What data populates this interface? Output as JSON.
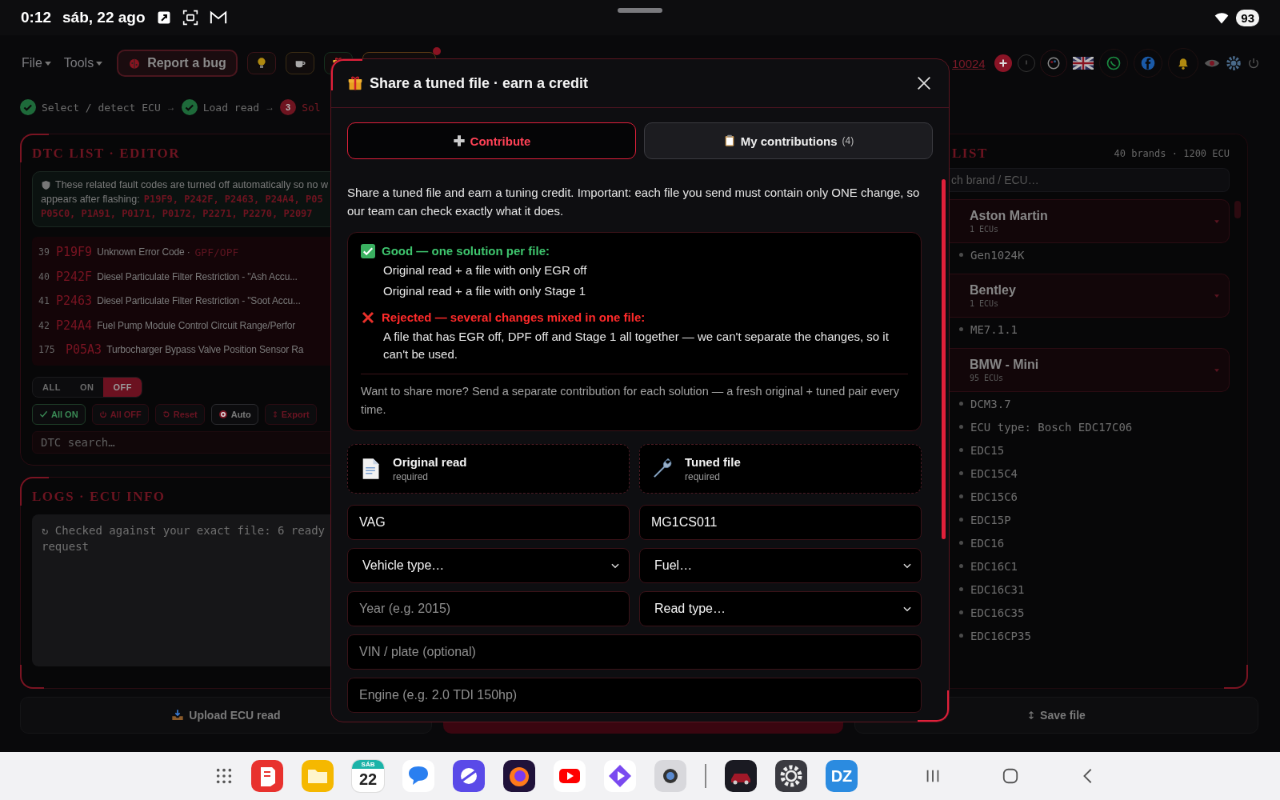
{
  "status_bar": {
    "time": "0:12",
    "date": "sáb, 22 ago",
    "battery": "93"
  },
  "toolbar": {
    "menus": [
      {
        "label": "File"
      },
      {
        "label": "Tools"
      }
    ],
    "report_button": "Report a bug",
    "credits": "10024"
  },
  "steps": [
    {
      "kind": "done",
      "label": "Select / detect ECU",
      "arrow": "→"
    },
    {
      "kind": "done",
      "label": "Load read",
      "arrow": "→"
    },
    {
      "kind": "current",
      "number": "3",
      "label": "Sol"
    }
  ],
  "dtc_panel": {
    "title": "DTC LIST · EDITOR",
    "notice": [
      {
        "text": "These related fault codes are turned off automatically so no w"
      },
      {
        "text": "appears after flashing:",
        "codes": "P19F9, P242F, P2463, P24A4, P05"
      },
      {
        "codes": "P05C0, P1A91, P0171, P0172, P2271, P2270, P2097"
      }
    ],
    "rows": [
      {
        "number": "39",
        "code": "P19F9",
        "description": "Unknown Error Code ·",
        "tag": "GPF/OPF"
      },
      {
        "number": "40",
        "code": "P242F",
        "description": "Diesel Particulate Filter Restriction - \"Ash Accu..."
      },
      {
        "number": "41",
        "code": "P2463",
        "description": "Diesel Particulate Filter Restriction - \"Soot Accu..."
      },
      {
        "number": "42",
        "code": "P24A4",
        "description": "Fuel Pump Module Control Circuit Range/Perfor"
      },
      {
        "number": "175",
        "code": "P05A3",
        "description": "Turbocharger Bypass Valve Position Sensor Ra"
      }
    ],
    "filter": [
      {
        "label": "ALL",
        "selected": false
      },
      {
        "label": "ON",
        "selected": false
      },
      {
        "label": "OFF",
        "selected": true
      }
    ],
    "actions": [
      {
        "kind": "enable",
        "label": "All ON"
      },
      {
        "kind": "disable",
        "label": "All OFF"
      },
      {
        "kind": "reset",
        "label": "Reset"
      },
      {
        "kind": "auto",
        "label": "Auto"
      },
      {
        "kind": "export",
        "label": "Export"
      }
    ],
    "search_placeholder": "DTC search…"
  },
  "logs_panel": {
    "title": "LOGS · ECU INFO",
    "lines": [
      "↻ Checked against your exact file: 6 ready",
      "request"
    ]
  },
  "bottom_bar": {
    "upload_button": "Upload ECU read",
    "save_button": "Save file"
  },
  "right_panel": {
    "title": "LIST",
    "count": "40 brands · 1200 ECU",
    "search_placeholder": "ch brand / ECU…",
    "brands": [
      {
        "name": "Aston Martin",
        "count": "1 ECUs",
        "expanded": true,
        "ecus": [
          "Gen1024K"
        ]
      },
      {
        "name": "Bentley",
        "count": "1 ECUs",
        "expanded": true,
        "ecus": [
          "ME7.1.1"
        ]
      },
      {
        "name": "BMW - Mini",
        "count": "95 ECUs",
        "expanded": true,
        "ecus": [
          "DCM3.7",
          "ECU type: Bosch EDC17C06",
          "EDC15",
          "EDC15C4",
          "EDC15C6",
          "EDC15P",
          "EDC16",
          "EDC16C1",
          "EDC16C31",
          "EDC16C35",
          "EDC16CP35"
        ]
      }
    ]
  },
  "modal": {
    "title": "Share a tuned file · earn a credit",
    "tabs": [
      {
        "label": "Contribute",
        "selected": true
      },
      {
        "label": "My contributions",
        "count": "(4)",
        "selected": false
      }
    ],
    "intro": "Share a tuned file and earn a tuning credit. Important: each file you send must contain only ONE change, so our team can check exactly what it does.",
    "rules": {
      "good_title": "Good — one solution per file:",
      "good_items": [
        "Original read + a file with only EGR off",
        "Original read + a file with only Stage 1"
      ],
      "rejected_title": "Rejected — several changes mixed in one file:",
      "rejected_items": [
        "A file that has EGR off, DPF off and Stage 1 all together — we can't separate the changes, so it can't be used."
      ],
      "note": "Want to share more? Send a separate contribution for each solution — a fresh original + tuned pair every time."
    },
    "uploads": [
      {
        "kind": "original",
        "title": "Original read",
        "hint": "required"
      },
      {
        "kind": "tuned",
        "title": "Tuned file",
        "hint": "required"
      }
    ],
    "fields": [
      {
        "kind": "input",
        "value": "VAG"
      },
      {
        "kind": "input",
        "value": "MG1CS011"
      },
      {
        "kind": "select",
        "value": "Vehicle type…"
      },
      {
        "kind": "select",
        "value": "Fuel…"
      },
      {
        "kind": "input",
        "placeholder": "Year (e.g. 2015)"
      },
      {
        "kind": "select",
        "value": "Read type…"
      },
      {
        "kind": "input",
        "placeholder": "VIN / plate (optional)",
        "wide": true
      },
      {
        "kind": "input",
        "placeholder": "Engine (e.g. 2.0 TDI 150hp)",
        "wide": true
      }
    ]
  },
  "taskbar": {
    "calendar": {
      "weekday": "SÁB",
      "day": "22"
    },
    "monogram": "DZ"
  }
}
